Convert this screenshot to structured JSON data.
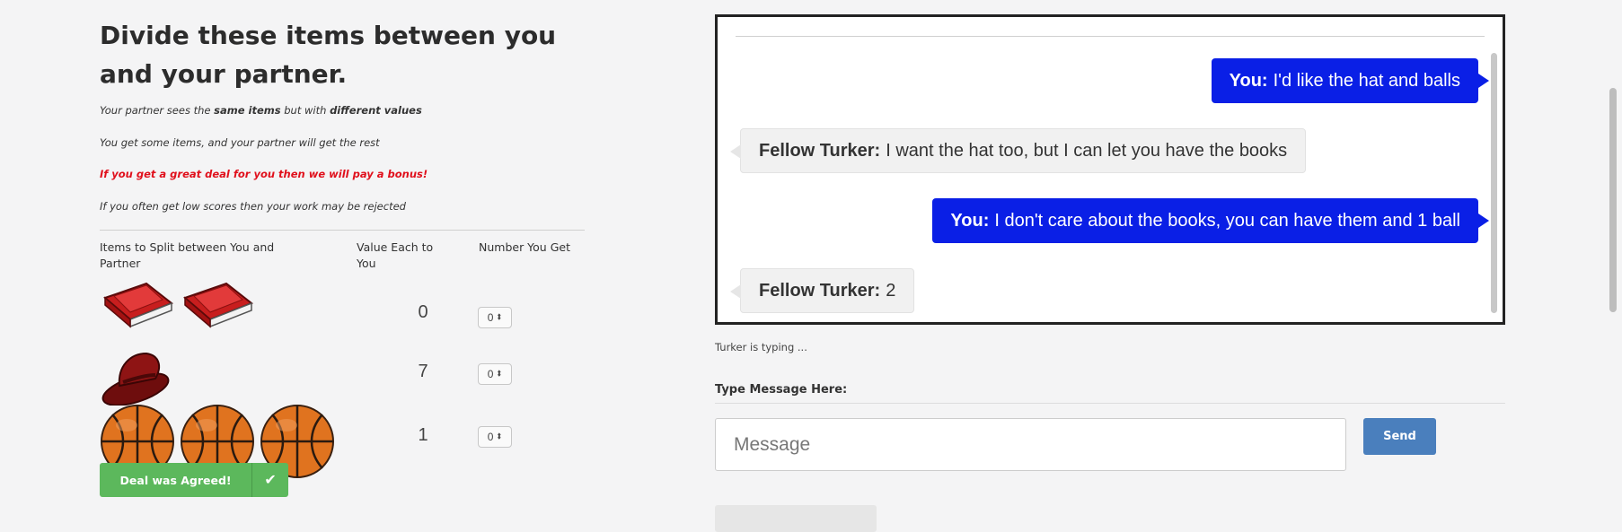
{
  "instructions": {
    "title": "Divide these items between you and your partner.",
    "note1_pre": "Your partner sees the ",
    "note1_b1": "same items",
    "note1_mid": " but with ",
    "note1_b2": "different values",
    "note2": "You get some items, and your partner will get the rest",
    "note3": "If you get a great deal for you then we will pay a bonus!",
    "note4": "If you often get low scores then your work may be rejected"
  },
  "table": {
    "headers": [
      "Items to Split between You and Partner",
      "Value Each to You",
      "Number You Get"
    ],
    "rows": [
      {
        "item": "book",
        "count": 2,
        "value": "0",
        "selected": "0"
      },
      {
        "item": "hat",
        "count": 1,
        "value": "7",
        "selected": "0"
      },
      {
        "item": "ball",
        "count": 3,
        "value": "1",
        "selected": "0"
      }
    ]
  },
  "deal_button": {
    "label": "Deal was Agreed!",
    "icon": "check-icon"
  },
  "chat": {
    "messages": [
      {
        "sender": "You:",
        "text": "I'd like the hat and balls",
        "mine": true
      },
      {
        "sender": "Fellow Turker:",
        "text": "I want the hat too, but I can let you have the books",
        "mine": false
      },
      {
        "sender": "You:",
        "text": "I don't care about the books, you can have them and 1 ball",
        "mine": true
      },
      {
        "sender": "Fellow Turker:",
        "text": "2",
        "mine": false
      }
    ],
    "typing_status": "Turker is typing ...",
    "input_label": "Type Message Here:",
    "input_placeholder": "Message",
    "send_label": "Send"
  },
  "colors": {
    "my_bubble": "#0a1fe6",
    "their_bubble": "#f1f1f1",
    "deal_green": "#5cb85c",
    "send_blue": "#4a7fbd",
    "bonus_red": "#e0101c"
  }
}
